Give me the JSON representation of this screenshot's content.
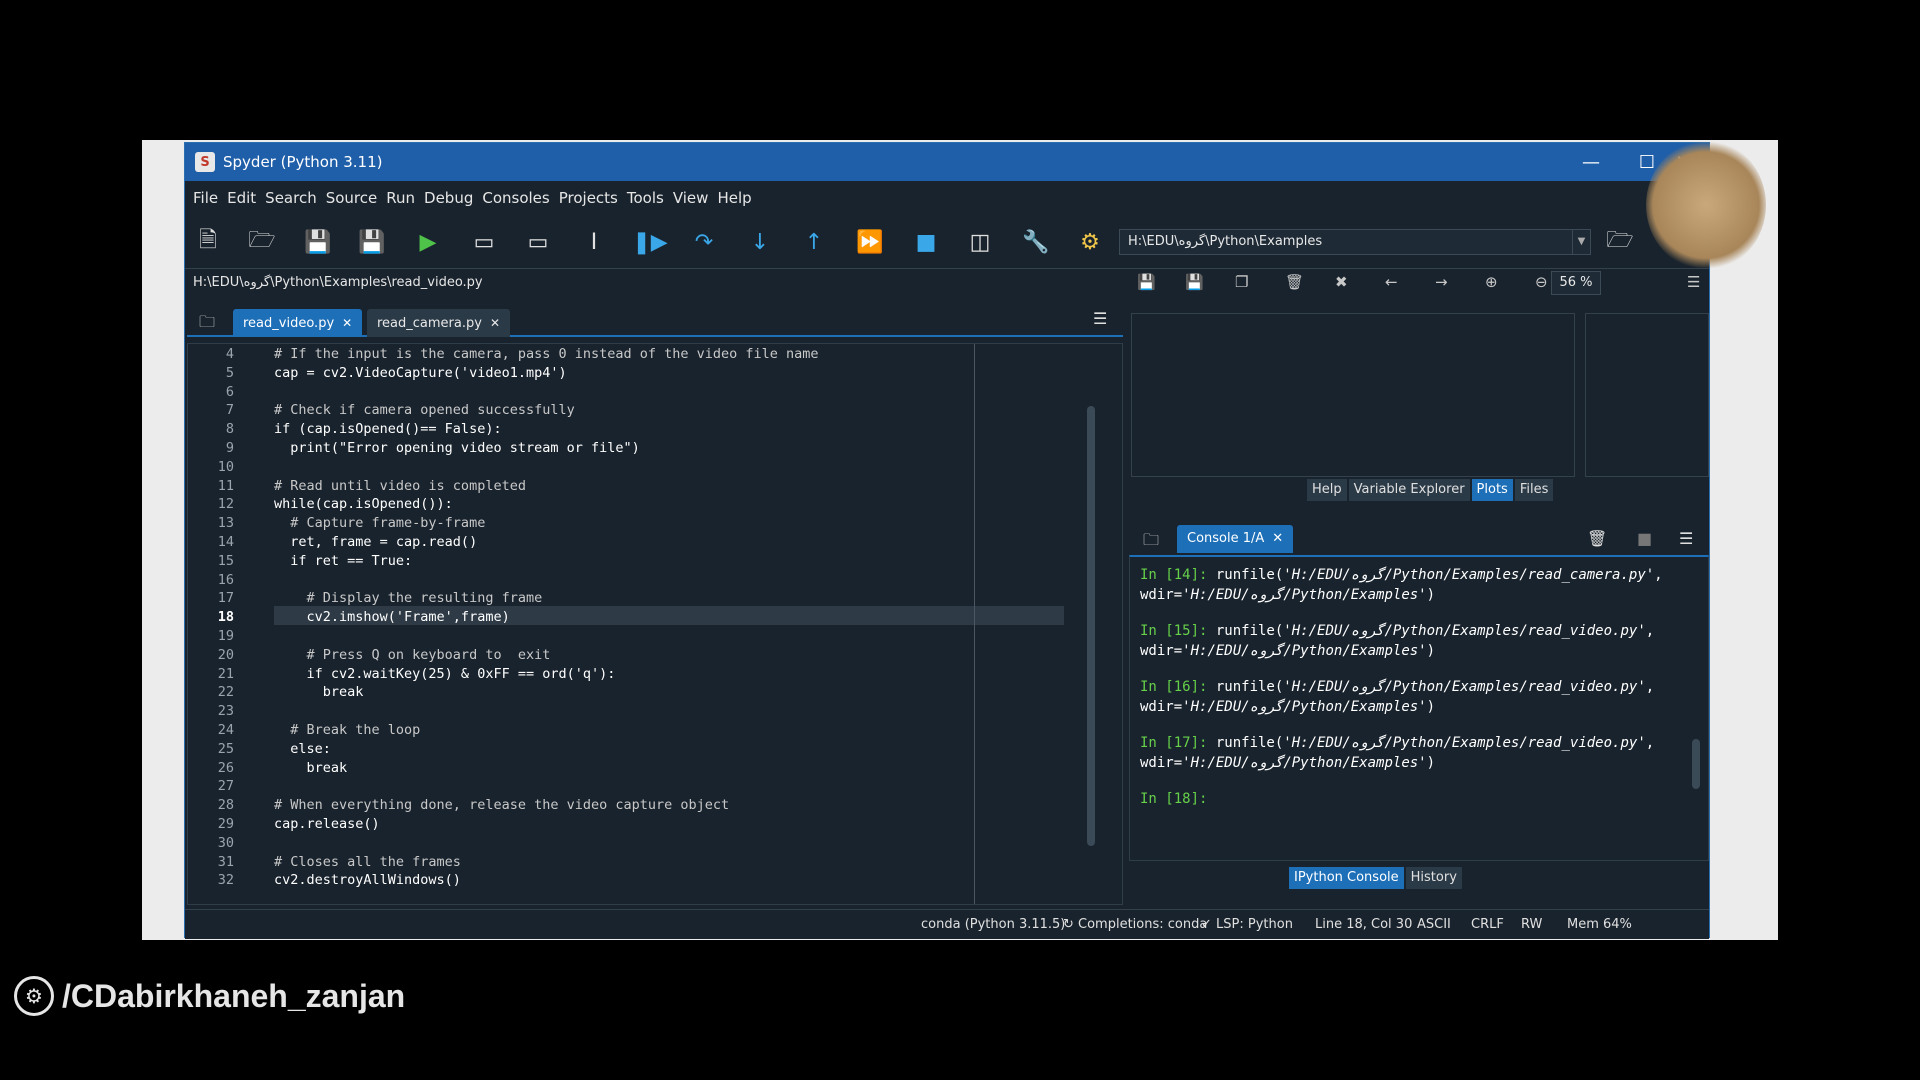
{
  "window": {
    "title": "Spyder (Python 3.11)"
  },
  "menu": [
    "File",
    "Edit",
    "Search",
    "Source",
    "Run",
    "Debug",
    "Consoles",
    "Projects",
    "Tools",
    "View",
    "Help"
  ],
  "toolbar": {
    "path": "H:\\EDU\\گروه\\Python\\Examples"
  },
  "editor": {
    "filepath": "H:\\EDU\\گروه\\Python\\Examples\\read_video.py",
    "tabs": [
      "read_video.py",
      "read_camera.py"
    ],
    "lines": [
      {
        "n": "4",
        "t": "# If the input is the camera, pass 0 instead of the video file name"
      },
      {
        "n": "5",
        "t": "cap = cv2.VideoCapture('video1.mp4')"
      },
      {
        "n": "6",
        "t": ""
      },
      {
        "n": "7",
        "t": "# Check if camera opened successfully"
      },
      {
        "n": "8",
        "t": "if (cap.isOpened()== False):"
      },
      {
        "n": "9",
        "t": "  print(\"Error opening video stream or file\")"
      },
      {
        "n": "10",
        "t": ""
      },
      {
        "n": "11",
        "t": "# Read until video is completed"
      },
      {
        "n": "12",
        "t": "while(cap.isOpened()):"
      },
      {
        "n": "13",
        "t": "  # Capture frame-by-frame"
      },
      {
        "n": "14",
        "t": "  ret, frame = cap.read()"
      },
      {
        "n": "15",
        "t": "  if ret == True:"
      },
      {
        "n": "16",
        "t": ""
      },
      {
        "n": "17",
        "t": "    # Display the resulting frame"
      },
      {
        "n": "18",
        "t": "    cv2.imshow('Frame',frame)"
      },
      {
        "n": "19",
        "t": ""
      },
      {
        "n": "20",
        "t": "    # Press Q on keyboard to  exit"
      },
      {
        "n": "21",
        "t": "    if cv2.waitKey(25) & 0xFF == ord('q'):"
      },
      {
        "n": "22",
        "t": "      break"
      },
      {
        "n": "23",
        "t": ""
      },
      {
        "n": "24",
        "t": "  # Break the loop"
      },
      {
        "n": "25",
        "t": "  else:"
      },
      {
        "n": "26",
        "t": "    break"
      },
      {
        "n": "27",
        "t": ""
      },
      {
        "n": "28",
        "t": "# When everything done, release the video capture object"
      },
      {
        "n": "29",
        "t": "cap.release()"
      },
      {
        "n": "30",
        "t": ""
      },
      {
        "n": "31",
        "t": "# Closes all the frames"
      },
      {
        "n": "32",
        "t": "cv2.destroyAllWindows()"
      }
    ],
    "current_line": "18"
  },
  "plots": {
    "zoom": "56 %",
    "tabs": [
      "Help",
      "Variable Explorer",
      "Plots",
      "Files"
    ],
    "active_tab": "Plots"
  },
  "console": {
    "tab": "Console 1/A",
    "entries": [
      {
        "prompt": "In [14]: ",
        "cmd": "runfile(",
        "file": "'H:/EDU/گروه/Python/Examples/read_camera.py'",
        "wdir": "'H:/EDU/گروه/Python/Examples'"
      },
      {
        "prompt": "In [15]: ",
        "cmd": "runfile(",
        "file": "'H:/EDU/گروه/Python/Examples/read_video.py'",
        "wdir": "'H:/EDU/گروه/Python/Examples'"
      },
      {
        "prompt": "In [16]: ",
        "cmd": "runfile(",
        "file": "'H:/EDU/گروه/Python/Examples/read_video.py'",
        "wdir": "'H:/EDU/گروه/Python/Examples'"
      },
      {
        "prompt": "In [17]: ",
        "cmd": "runfile(",
        "file": "'H:/EDU/گروه/Python/Examples/read_video.py'",
        "wdir": "'H:/EDU/گروه/Python/Examples'"
      }
    ],
    "last_prompt": "In [18]:",
    "bottom_tabs": [
      "IPython Console",
      "History"
    ]
  },
  "status": {
    "env": "conda (Python 3.11.5)",
    "completions": "Completions: conda",
    "lsp": "LSP: Python",
    "position": "Line 18, Col 30",
    "encoding": "ASCII",
    "eol": "CRLF",
    "mode": "RW",
    "mem": "Mem 64%"
  },
  "watermark": "/CDabirkhaneh_zanjan",
  "colors": {
    "accent": "#1d6fb8",
    "background": "#19232d",
    "titlebar": "#1f5ea8",
    "prompt": "#66d04a",
    "keyword": "#c678dd"
  }
}
